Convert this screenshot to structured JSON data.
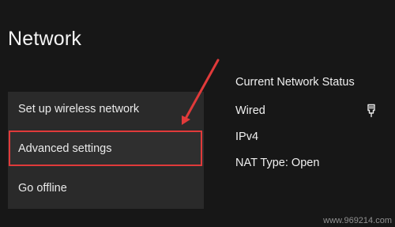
{
  "page": {
    "title": "Network"
  },
  "menu": {
    "items": [
      {
        "label": "Set up wireless network"
      },
      {
        "label": "Advanced settings"
      },
      {
        "label": "Go offline"
      }
    ]
  },
  "status": {
    "title": "Current Network Status",
    "connection": "Wired",
    "ip_version": "IPv4",
    "nat_type": "NAT Type: Open",
    "connection_icon": "ethernet-icon"
  },
  "annotation": {
    "highlight_color": "#e03a3a",
    "arrow_color": "#e03a3a"
  },
  "watermark": {
    "text": "www.969214.com"
  }
}
